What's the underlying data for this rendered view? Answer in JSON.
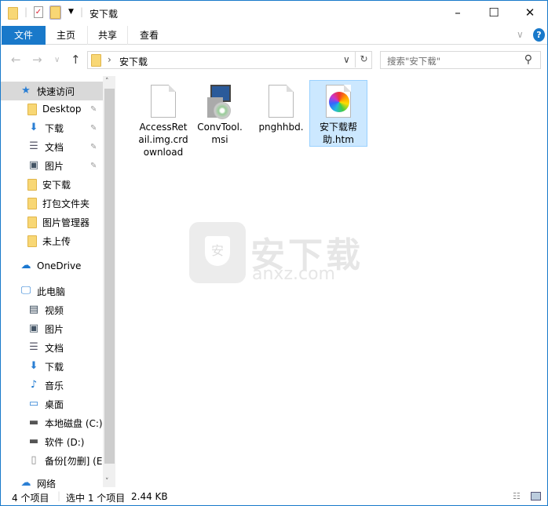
{
  "window": {
    "title": "安下载",
    "minimize": "–",
    "maximize": "☐",
    "close": "✕",
    "accent": "#1979ca"
  },
  "ribbon": {
    "tabs": [
      "文件",
      "主页",
      "共享",
      "查看"
    ],
    "help": "?",
    "expand": "∨"
  },
  "address": {
    "path": "安下载",
    "separator": "›",
    "dropdown": "∨",
    "refresh": "↻",
    "search_placeholder": "搜索\"安下载\"",
    "search_icon": "⚲"
  },
  "navigation": {
    "back": "←",
    "forward": "→",
    "recent": "∨",
    "up": "↑"
  },
  "sidebar": {
    "items": [
      {
        "label": "快速访问",
        "icon": "star-icon",
        "glyph": "★",
        "level": 0,
        "selected": true
      },
      {
        "label": "Desktop",
        "icon": "folder-icon",
        "level": 1,
        "pinned": true
      },
      {
        "label": "下载",
        "icon": "download-icon",
        "glyph": "⬇",
        "level": 1,
        "pinned": true
      },
      {
        "label": "文档",
        "icon": "document-icon",
        "glyph": "☰",
        "level": 1,
        "pinned": true
      },
      {
        "label": "图片",
        "icon": "pictures-icon",
        "glyph": "▣",
        "level": 1,
        "pinned": true
      },
      {
        "label": "安下载",
        "icon": "folder-icon",
        "level": 1
      },
      {
        "label": "打包文件夹",
        "icon": "folder-icon",
        "level": 1
      },
      {
        "label": "图片管理器",
        "icon": "folder-icon",
        "level": 1
      },
      {
        "label": "未上传",
        "icon": "folder-icon",
        "level": 1
      },
      {
        "label": "OneDrive",
        "icon": "cloud-icon",
        "glyph": "☁",
        "level": 0
      },
      {
        "label": "此电脑",
        "icon": "computer-icon",
        "glyph": "🖵",
        "level": 0
      },
      {
        "label": "视频",
        "icon": "video-icon",
        "glyph": "▤",
        "level": 1
      },
      {
        "label": "图片",
        "icon": "pictures-icon",
        "glyph": "▣",
        "level": 1
      },
      {
        "label": "文档",
        "icon": "document-icon",
        "glyph": "☰",
        "level": 1
      },
      {
        "label": "下载",
        "icon": "download-icon",
        "glyph": "⬇",
        "level": 1
      },
      {
        "label": "音乐",
        "icon": "music-icon",
        "glyph": "♪",
        "level": 1
      },
      {
        "label": "桌面",
        "icon": "desktop-icon",
        "glyph": "▭",
        "level": 1
      },
      {
        "label": "本地磁盘 (C:)",
        "icon": "drive-icon",
        "glyph": "▬",
        "level": 1
      },
      {
        "label": "软件 (D:)",
        "icon": "drive-icon",
        "glyph": "▬",
        "level": 1
      },
      {
        "label": "备份[勿删] (E:",
        "icon": "file-icon",
        "glyph": "▯",
        "level": 1
      },
      {
        "label": "网络",
        "icon": "network-icon",
        "glyph": "☁",
        "level": 0
      }
    ],
    "pin_glyph": "📌"
  },
  "files": [
    {
      "name": "AccessRetail.img.crdownload",
      "lines": [
        "AccessRet",
        "ail.img.crd",
        "ownload"
      ],
      "icon": "blank-file-icon"
    },
    {
      "name": "ConvTool.msi",
      "lines": [
        "ConvTool.",
        "msi"
      ],
      "icon": "installer-icon"
    },
    {
      "name": "pnghhbd.",
      "lines": [
        "pnghhbd."
      ],
      "icon": "blank-file-icon"
    },
    {
      "name": "安下载帮助.htm",
      "lines": [
        "安下载帮",
        "助.htm"
      ],
      "icon": "browser-file-icon",
      "selected": true
    }
  ],
  "watermark": {
    "text": "安下载",
    "domain": "anxz.com"
  },
  "status": {
    "count": "4 个项目",
    "selection": "选中 1 个项目",
    "size": "2.44 KB"
  }
}
